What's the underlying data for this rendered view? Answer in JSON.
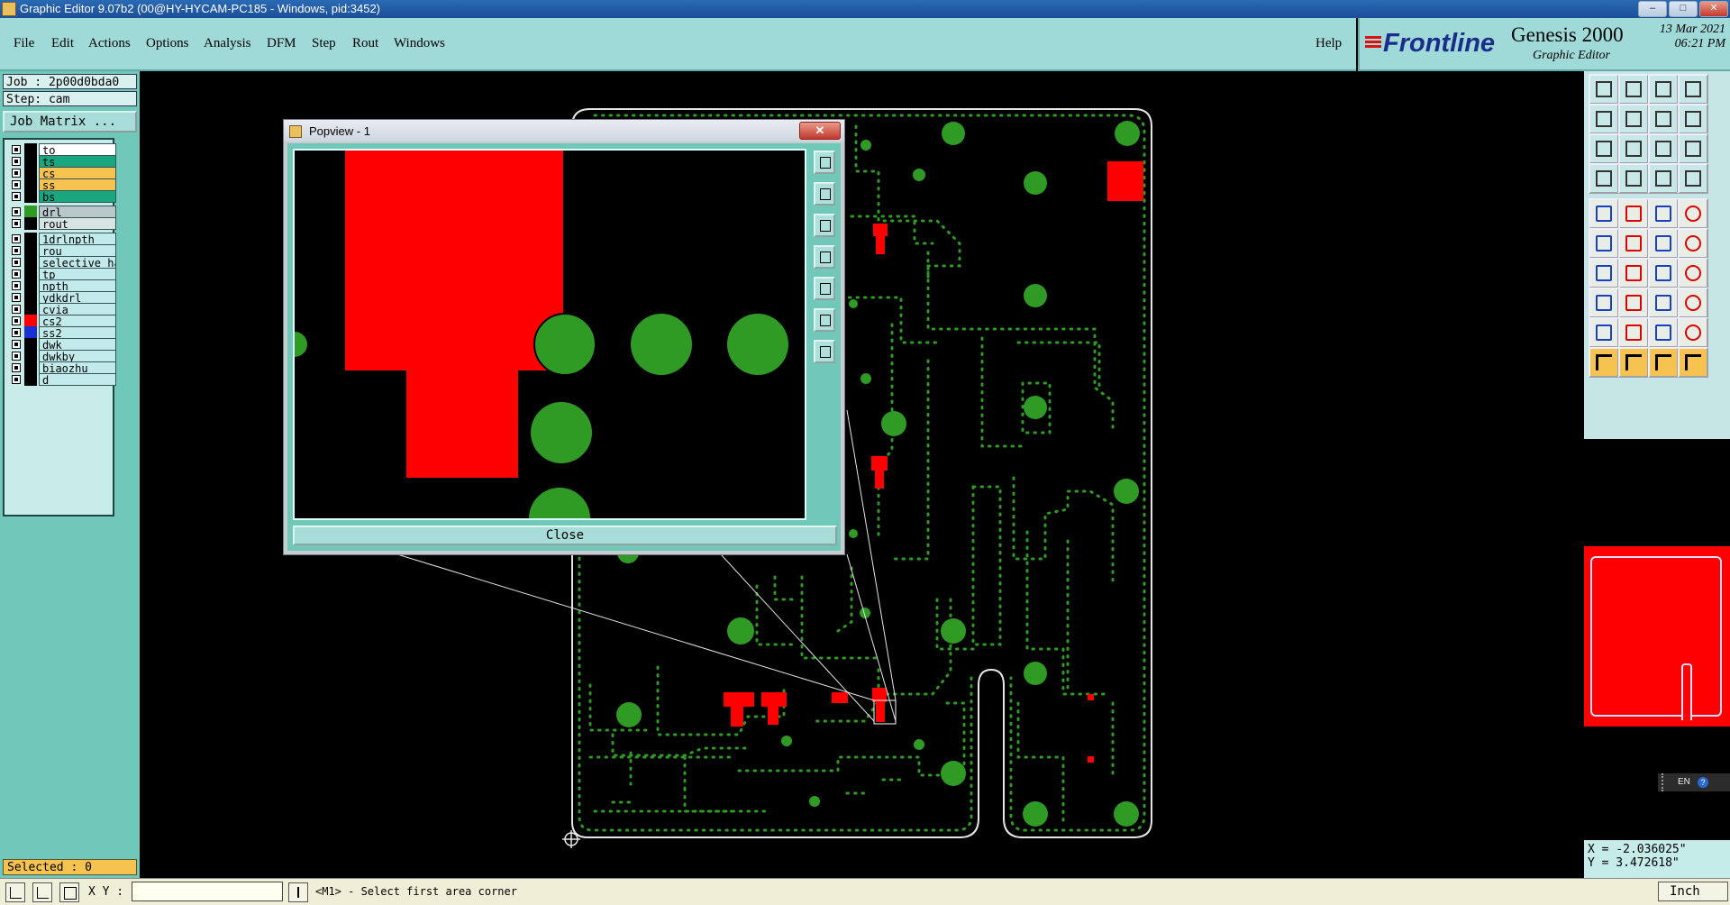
{
  "window": {
    "title": "Graphic Editor 9.07b2 (00@HY-HYCAM-PC185 - Windows, pid:3452)",
    "controls": [
      "–",
      "□",
      "✕"
    ]
  },
  "menu": {
    "items": [
      "File",
      "Edit",
      "Actions",
      "Options",
      "Analysis",
      "DFM",
      "Step",
      "Rout",
      "Windows"
    ],
    "help": "Help"
  },
  "brand": {
    "logo": "Frontline",
    "product": "Genesis 2000",
    "subtitle": "Graphic Editor",
    "date": "13 Mar 2021",
    "time": "06:21 PM"
  },
  "job": {
    "job_label": "Job : 2p00d0bda0",
    "step_label": "Step: cam",
    "matrix_button": "Job Matrix ..."
  },
  "layers": [
    {
      "name": "to",
      "bg": "#ffffff",
      "swatch": "#000000"
    },
    {
      "name": "ts",
      "bg": "#1aa67f",
      "swatch": "#000000"
    },
    {
      "name": "cs",
      "bg": "#f6c350",
      "swatch": "#000000"
    },
    {
      "name": "ss",
      "bg": "#f6c350",
      "swatch": "#000000"
    },
    {
      "name": "bs",
      "bg": "#1aa67f",
      "swatch": "#000000"
    },
    {
      "name": "drl",
      "bg": "#b8c8c8",
      "swatch": "#2f9a24"
    },
    {
      "name": "rout",
      "bg": "#d8e4e4",
      "swatch": "#000000"
    },
    {
      "name": "1drlnpth",
      "bg": "#c2eaea",
      "swatch": "#000000"
    },
    {
      "name": "rou",
      "bg": "#c2eaea",
      "swatch": "#000000"
    },
    {
      "name": "selective_ha",
      "bg": "#c2eaea",
      "swatch": "#000000"
    },
    {
      "name": "tp",
      "bg": "#c2eaea",
      "swatch": "#000000"
    },
    {
      "name": "npth",
      "bg": "#c2eaea",
      "swatch": "#000000"
    },
    {
      "name": "ydkdrl",
      "bg": "#c2eaea",
      "swatch": "#000000"
    },
    {
      "name": "cvia",
      "bg": "#c2eaea",
      "swatch": "#000000"
    },
    {
      "name": "cs2",
      "bg": "#c2eaea",
      "swatch": "#ff0000"
    },
    {
      "name": "ss2",
      "bg": "#c2eaea",
      "swatch": "#1b2fd6"
    },
    {
      "name": "dwk",
      "bg": "#c2eaea",
      "swatch": "#000000"
    },
    {
      "name": "dwkby",
      "bg": "#c2eaea",
      "swatch": "#000000"
    },
    {
      "name": "biaozhu",
      "bg": "#c2eaea",
      "swatch": "#000000"
    },
    {
      "name": "d",
      "bg": "#c2eaea",
      "swatch": "#000000"
    }
  ],
  "selected": "Selected : 0",
  "popview": {
    "title": "Popview - 1",
    "close_x": "✕",
    "close_button": "Close"
  },
  "coords": {
    "x": "X = -2.036025\"",
    "y": "Y = 3.472618\""
  },
  "lang": {
    "code": "EN",
    "help": "?"
  },
  "status": {
    "xy_label": "X Y :",
    "xy_value": "",
    "prompt": "<M1> - Select first area corner",
    "unit": "Inch"
  },
  "colors": {
    "board_green": "#2f9a24",
    "pad_red": "#ff0000",
    "panel_teal": "#6fc8b8",
    "menu_teal": "#9fd9d8"
  }
}
